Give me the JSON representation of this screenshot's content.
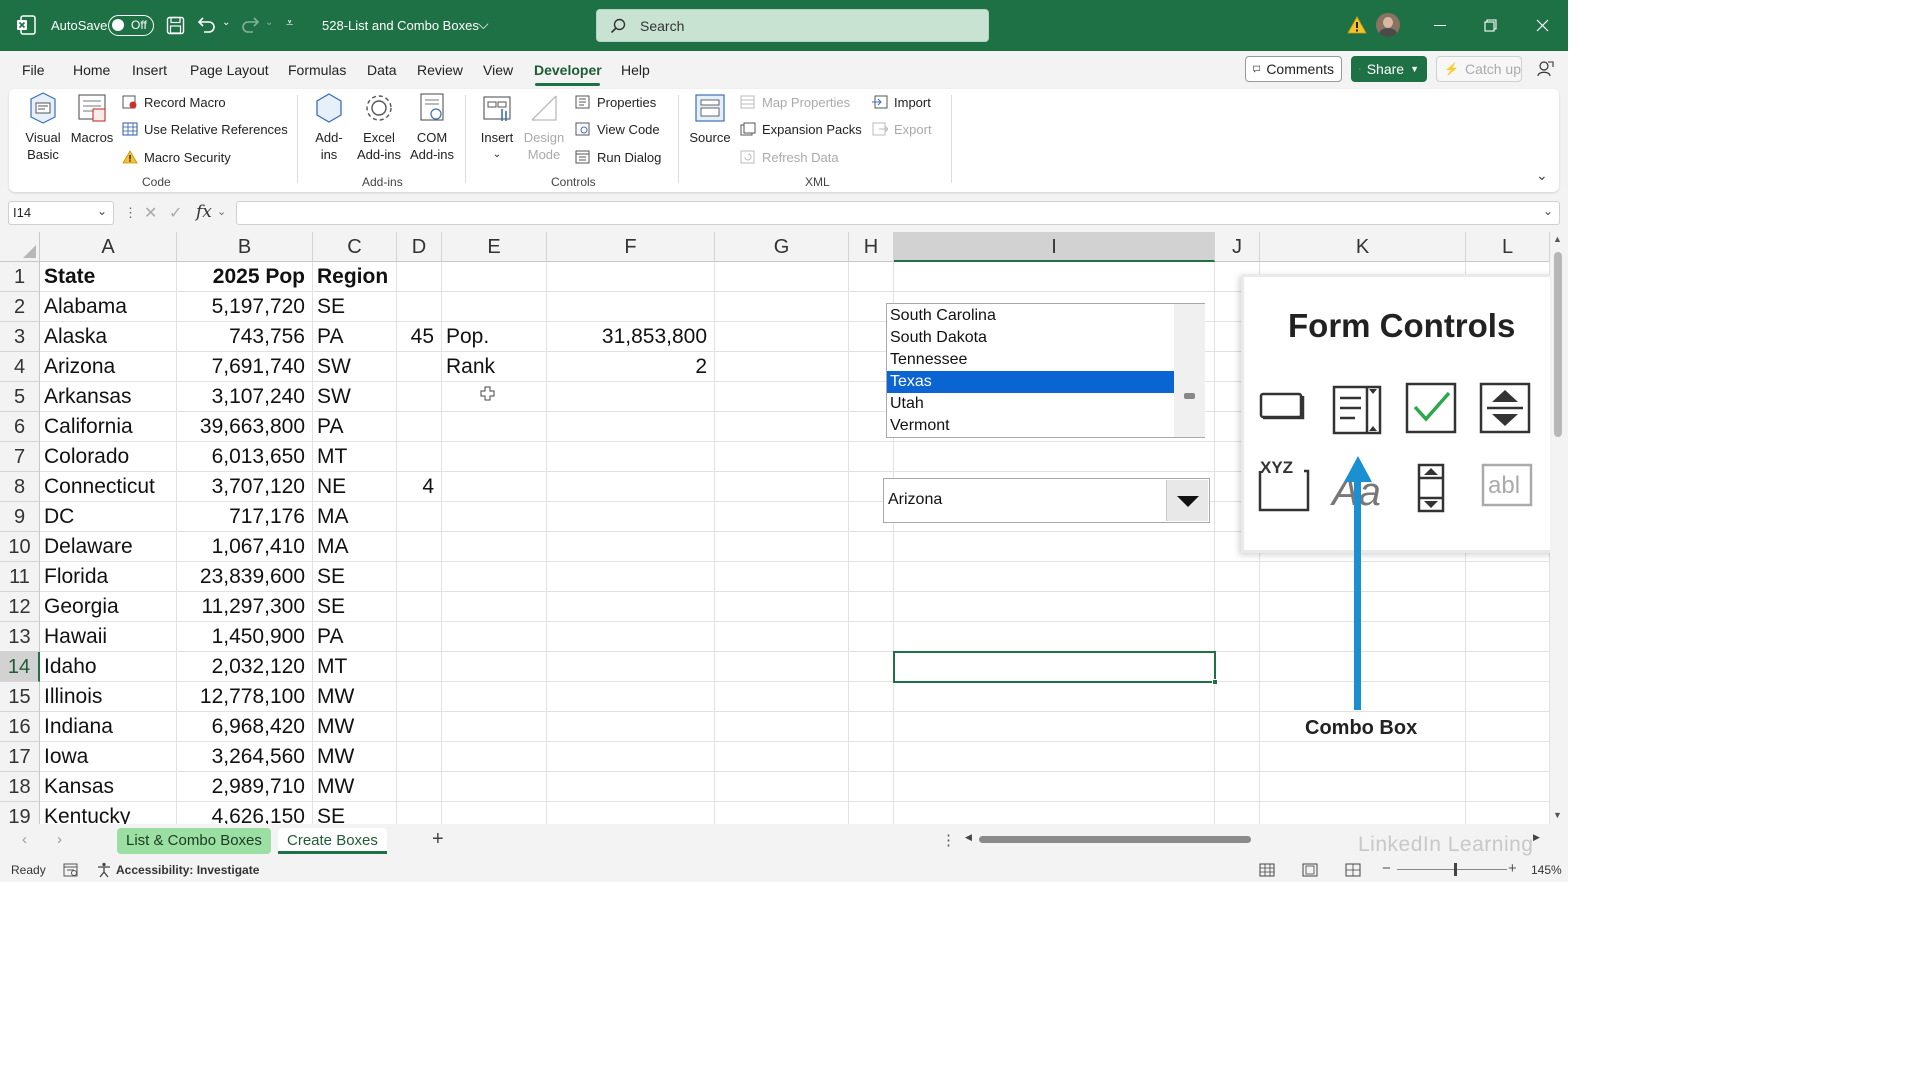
{
  "titlebar": {
    "autosave_label": "AutoSave",
    "toggle_state": "Off",
    "filename": "528-List and Combo Boxes",
    "search_placeholder": "Search",
    "bg_color": "#1e7145"
  },
  "menu": {
    "tabs": [
      "File",
      "Home",
      "Insert",
      "Page Layout",
      "Formulas",
      "Data",
      "Review",
      "View",
      "Developer",
      "Help"
    ],
    "active": "Developer",
    "comments": "Comments",
    "share": "Share",
    "catch_up": "Catch up"
  },
  "ribbon": {
    "code": {
      "visual_basic": [
        "Visual",
        "Basic"
      ],
      "macros": "Macros",
      "record_macro": "Record Macro",
      "use_relative": "Use Relative References",
      "macro_security": "Macro Security",
      "label": "Code"
    },
    "addins": {
      "addins": [
        "Add-",
        "ins"
      ],
      "excel_addins": [
        "Excel",
        "Add-ins"
      ],
      "com_addins": [
        "COM",
        "Add-ins"
      ],
      "label": "Add-ins"
    },
    "controls": {
      "insert": "Insert",
      "design_mode": [
        "Design",
        "Mode"
      ],
      "properties": "Properties",
      "view_code": "View Code",
      "run_dialog": "Run Dialog",
      "label": "Controls"
    },
    "xml": {
      "source": "Source",
      "map_properties": "Map Properties",
      "expansion_packs": "Expansion Packs",
      "refresh_data": "Refresh Data",
      "import": "Import",
      "export": "Export",
      "label": "XML"
    }
  },
  "formula_bar": {
    "name_box": "I14",
    "fx": "fx",
    "formula": ""
  },
  "grid": {
    "columns": [
      "A",
      "B",
      "C",
      "D",
      "E",
      "F",
      "G",
      "H",
      "I",
      "J",
      "K",
      "L"
    ],
    "selected_column": "I",
    "rows": [
      "1",
      "2",
      "3",
      "4",
      "5",
      "6",
      "7",
      "8",
      "9",
      "10",
      "11",
      "12",
      "13",
      "14",
      "15",
      "16",
      "17",
      "18",
      "19"
    ],
    "selected_row": "14",
    "headers": {
      "state": "State",
      "pop": "2025 Pop",
      "region": "Region"
    },
    "data": [
      [
        "Alabama",
        "5,197,720",
        "SE"
      ],
      [
        "Alaska",
        "743,756",
        "PA"
      ],
      [
        "Arizona",
        "7,691,740",
        "SW"
      ],
      [
        "Arkansas",
        "3,107,240",
        "SW"
      ],
      [
        "California",
        "39,663,800",
        "PA"
      ],
      [
        "Colorado",
        "6,013,650",
        "MT"
      ],
      [
        "Connecticut",
        "3,707,120",
        "NE"
      ],
      [
        "DC",
        "717,176",
        "MA"
      ],
      [
        "Delaware",
        "1,067,410",
        "MA"
      ],
      [
        "Florida",
        "23,839,600",
        "SE"
      ],
      [
        "Georgia",
        "11,297,300",
        "SE"
      ],
      [
        "Hawaii",
        "1,450,900",
        "PA"
      ],
      [
        "Idaho",
        "2,032,120",
        "MT"
      ],
      [
        "Illinois",
        "12,778,100",
        "MW"
      ],
      [
        "Indiana",
        "6,968,420",
        "MW"
      ],
      [
        "Iowa",
        "3,264,560",
        "MW"
      ],
      [
        "Kansas",
        "2,989,710",
        "MW"
      ],
      [
        "Kentucky",
        "4,626,150",
        "SE"
      ]
    ],
    "d3": "45",
    "e3": "Pop.",
    "f3": "31,853,800",
    "e4": "Rank",
    "f4": "2",
    "d8": "4"
  },
  "listbox": {
    "items": [
      "South Carolina",
      "South Dakota",
      "Tennessee",
      "Texas",
      "Utah",
      "Vermont"
    ],
    "selected": "Texas",
    "selected_color": "#0a64d2"
  },
  "combobox": {
    "value": "Arizona"
  },
  "form_controls_panel": {
    "title": "Form Controls",
    "icons": [
      "button-icon",
      "combo-box-icon",
      "check-box-icon",
      "spin-button-icon",
      "group-box-icon",
      "label-icon",
      "scroll-bar-icon",
      "text-field-icon"
    ],
    "caption": "Combo Box",
    "arrow_color": "#1a8fd1"
  },
  "sheets": {
    "tabs": [
      "List & Combo Boxes",
      "Create Boxes"
    ],
    "active": "Create Boxes",
    "first_tab_color": "#9be0a2"
  },
  "status": {
    "ready": "Ready",
    "accessibility": "Accessibility: Investigate",
    "zoom": "145%"
  },
  "watermark": "LinkedIn Learning"
}
